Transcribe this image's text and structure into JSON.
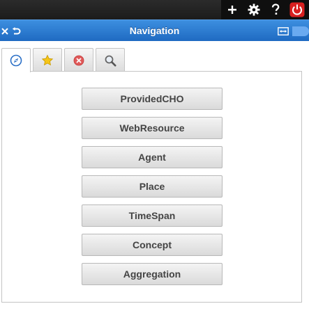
{
  "topbar": {
    "tools": [
      {
        "icon": "plus-icon"
      },
      {
        "icon": "gear-icon"
      },
      {
        "icon": "help-icon"
      },
      {
        "icon": "power-icon"
      }
    ]
  },
  "header": {
    "title": "Navigation",
    "left_icons": [
      "close-icon",
      "back-icon"
    ],
    "right_icons": [
      "expand-icon"
    ]
  },
  "tabs": [
    {
      "icon": "compass-icon",
      "active": true
    },
    {
      "icon": "star-icon",
      "active": false
    },
    {
      "icon": "cancel-icon",
      "active": false
    },
    {
      "icon": "search-icon",
      "active": false
    }
  ],
  "buttons": [
    {
      "label": "ProvidedCHO"
    },
    {
      "label": "WebResource"
    },
    {
      "label": "Agent"
    },
    {
      "label": "Place"
    },
    {
      "label": "TimeSpan"
    },
    {
      "label": "Concept"
    },
    {
      "label": "Aggregation"
    }
  ],
  "colors": {
    "header_blue": "#2a7ad4",
    "power_red": "#d82020",
    "button_text": "#444444"
  }
}
